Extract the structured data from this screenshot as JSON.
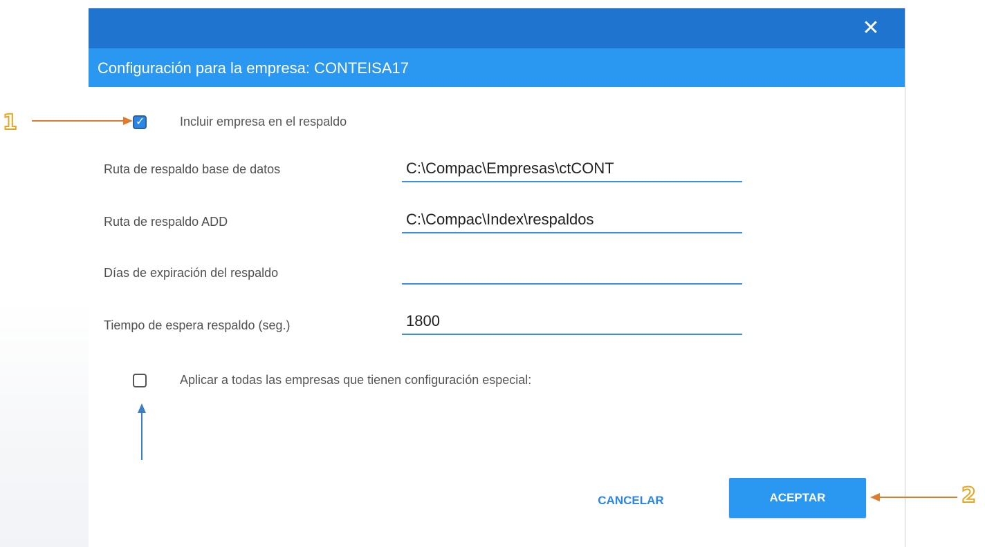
{
  "dialog": {
    "close_glyph": "✕",
    "header_title": "Configuración para la empresa: CONTEISA17"
  },
  "include_checkbox": {
    "label": "Incluir empresa en el respaldo",
    "checked": true,
    "check_glyph": "✓"
  },
  "fields": [
    {
      "label": "Ruta de respaldo base de datos",
      "value": "C:\\Compac\\Empresas\\ctCONT"
    },
    {
      "label": "Ruta de respaldo ADD",
      "value": "C:\\Compac\\Index\\respaldos"
    },
    {
      "label": "Días de expiración del respaldo",
      "value": ""
    },
    {
      "label": "Tiempo de espera respaldo (seg.)",
      "value": "1800"
    }
  ],
  "apply_all_checkbox": {
    "label": "Aplicar a todas las empresas que tienen configuración especial:",
    "checked": false
  },
  "buttons": {
    "cancel": "CANCELAR",
    "accept": "ACEPTAR"
  },
  "annotations": {
    "marker_1": "1",
    "marker_2": "2",
    "orange_color": "#e07b2e",
    "blue_color": "#3a7fc4",
    "number_outline_color": "#e9a51f"
  },
  "colors": {
    "titlebar": "#1f74cf",
    "header": "#2a97f0",
    "accent": "#2a86e6"
  }
}
